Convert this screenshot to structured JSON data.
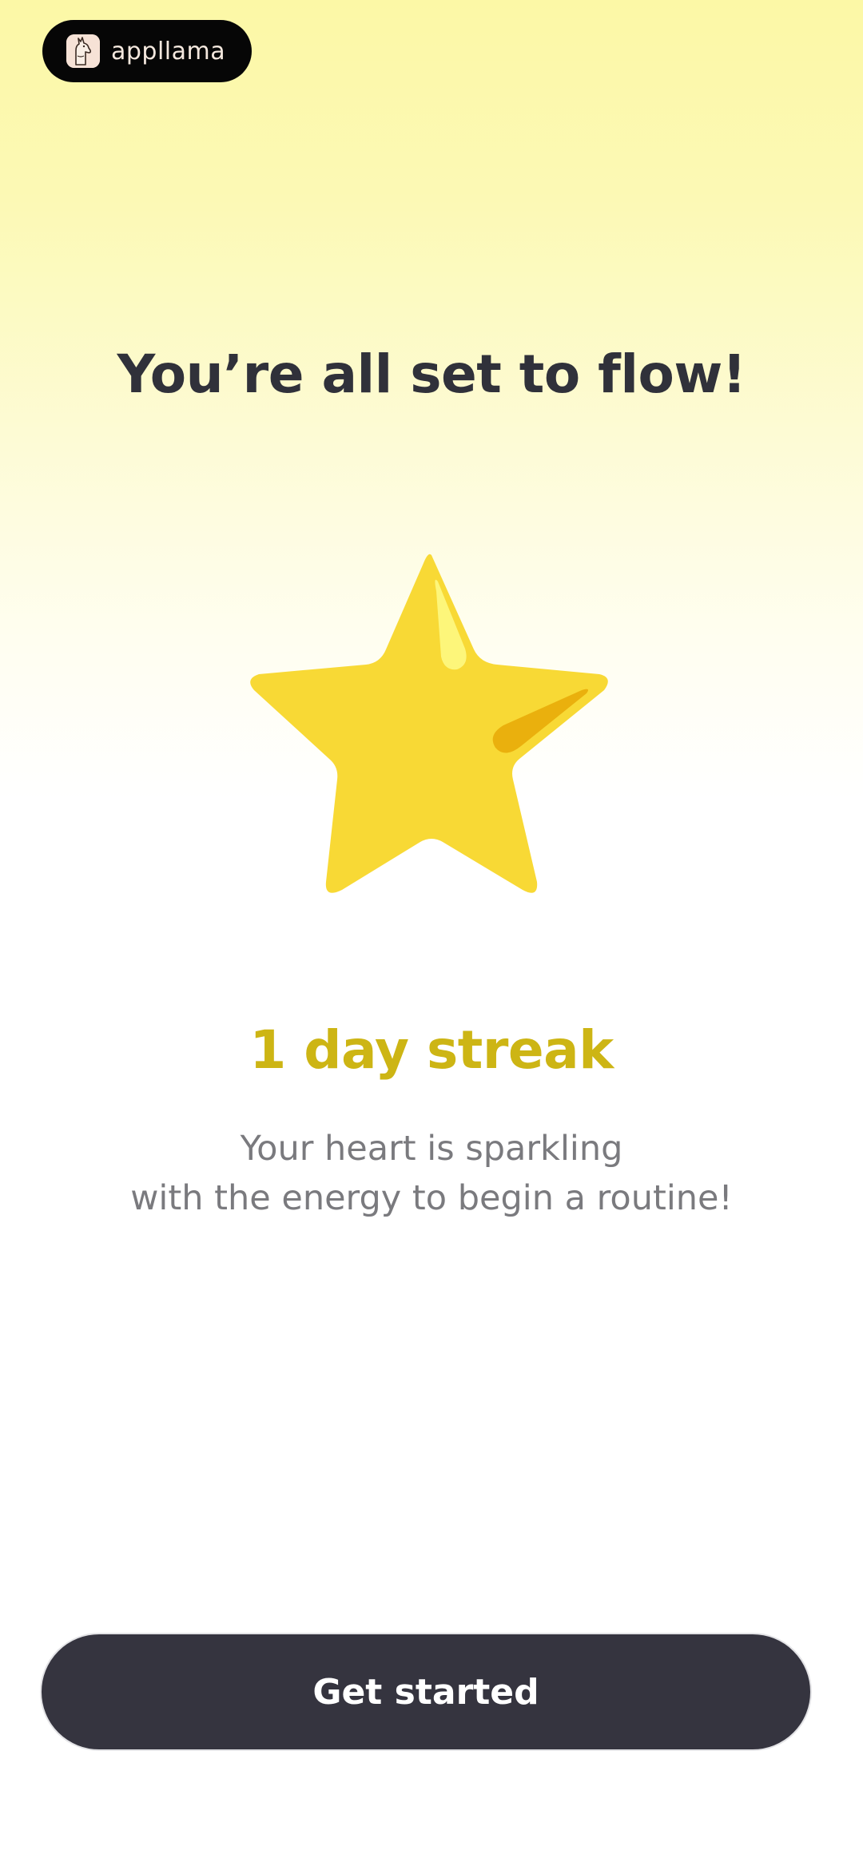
{
  "brand": {
    "name": "appllama",
    "logo_icon": "llama-icon"
  },
  "page": {
    "title": "You’re all set to flow!"
  },
  "streak": {
    "icon": "star-icon",
    "title": "1 day streak",
    "message_line1": "Your heart is sparkling",
    "message_line2": "with the energy to begin a routine!"
  },
  "cta": {
    "label": "Get started"
  },
  "colors": {
    "background_top": "#fcf8a6",
    "title_text": "#30313a",
    "streak_accent": "#cdb514",
    "star_fill": "#f8d935",
    "button_bg": "#35343f"
  }
}
